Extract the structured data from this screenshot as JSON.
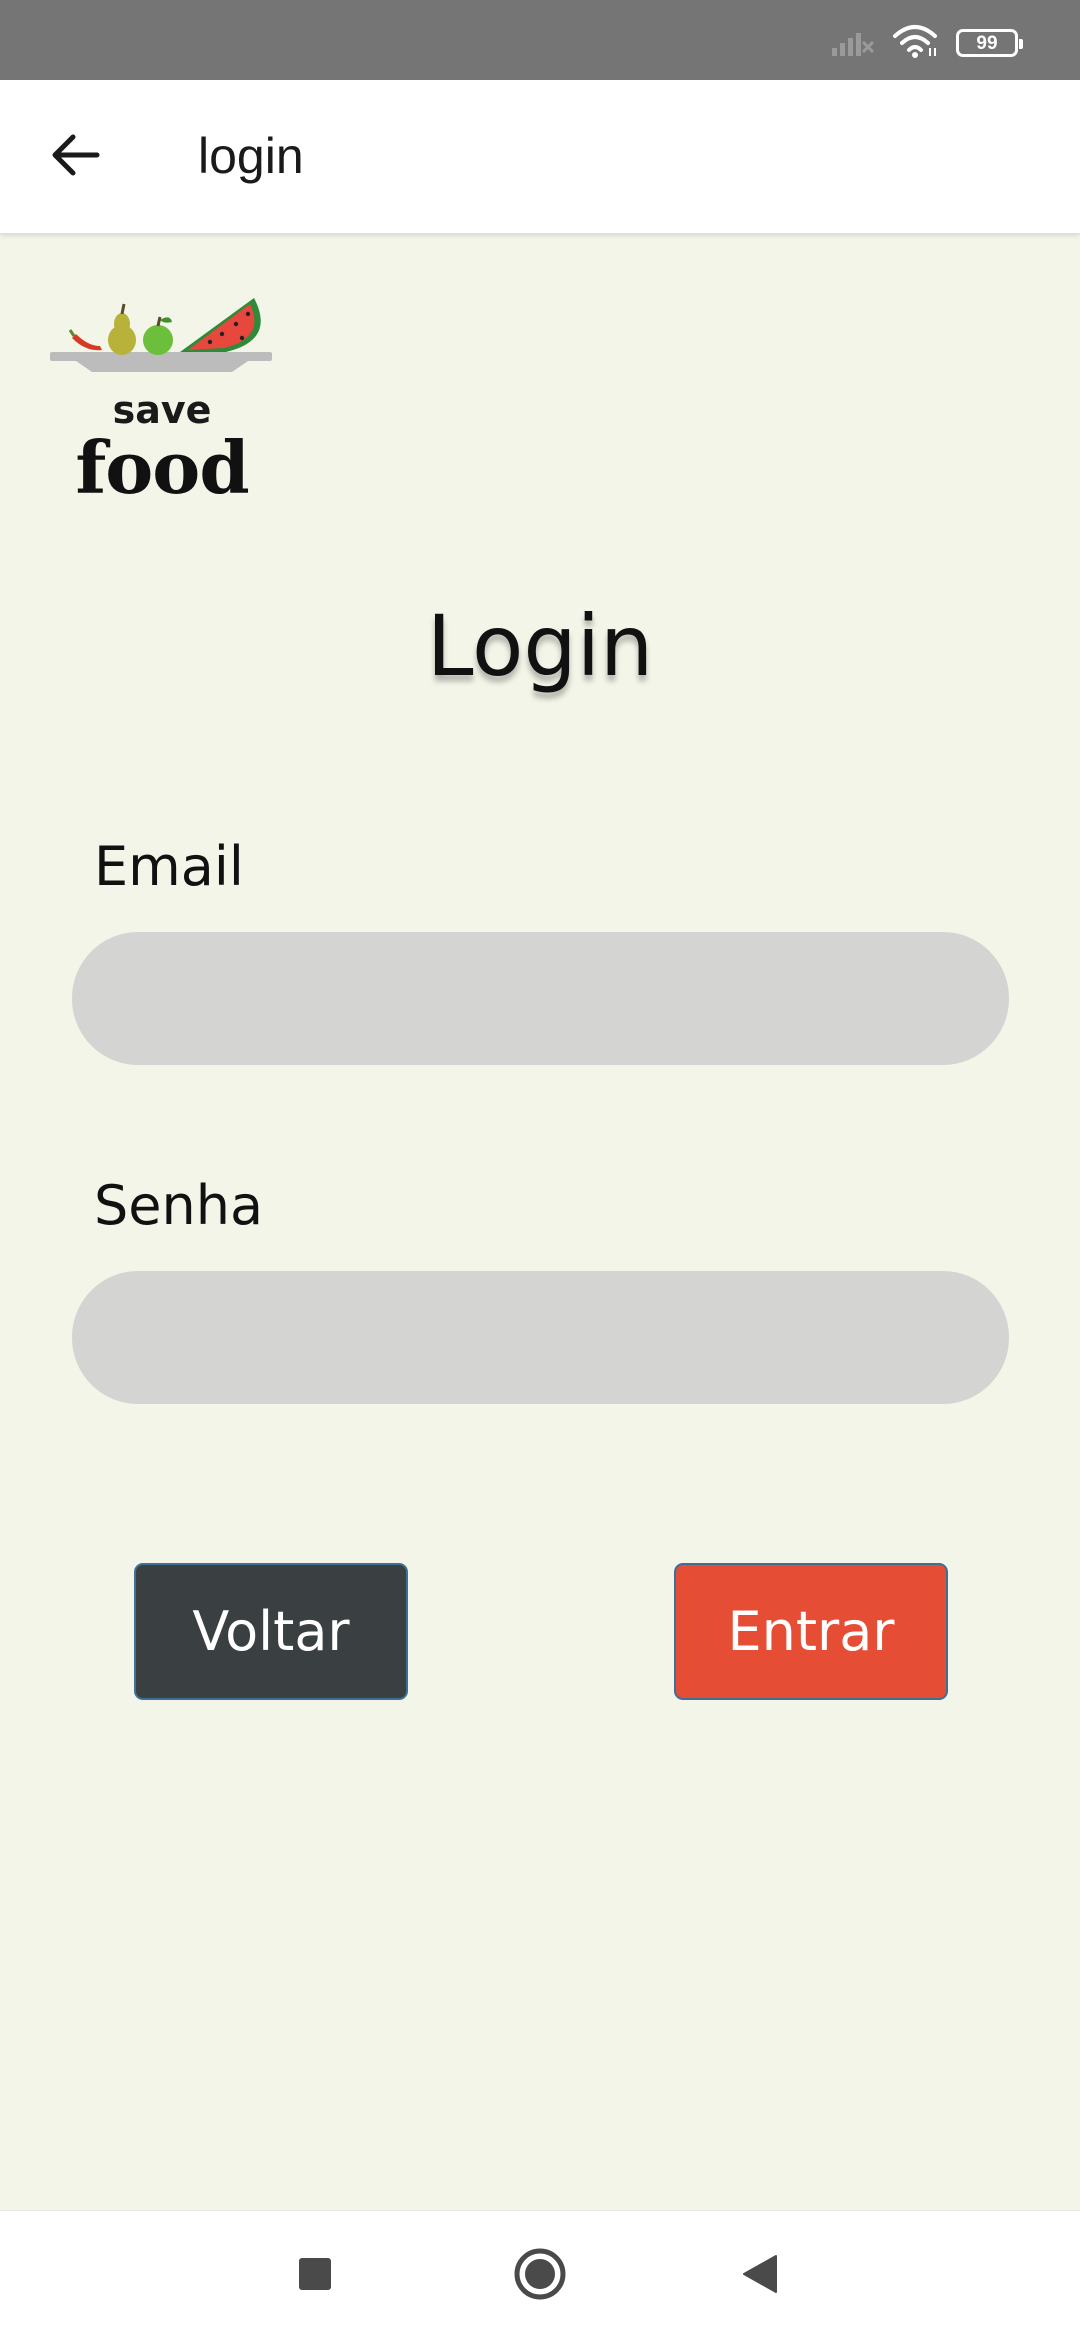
{
  "status_bar": {
    "battery_level": "99",
    "icons": [
      "signal-off-icon",
      "wifi-icon",
      "battery-icon"
    ]
  },
  "app_bar": {
    "title": "login",
    "back_icon": "arrow-left-icon"
  },
  "logo": {
    "line1": "save",
    "line2": "food"
  },
  "heading": "Login",
  "form": {
    "email_label": "Email",
    "email_value": "",
    "password_label": "Senha",
    "password_value": ""
  },
  "buttons": {
    "back_label": "Voltar",
    "submit_label": "Entrar"
  },
  "nav_bar": {
    "icons": [
      "recents-square-icon",
      "home-circle-icon",
      "back-triangle-icon"
    ]
  },
  "colors": {
    "background": "#f3f5e9",
    "status_bar": "#757575",
    "input_fill": "#d4d4d2",
    "back_button": "#3a3f42",
    "submit_button": "#e64d35"
  }
}
